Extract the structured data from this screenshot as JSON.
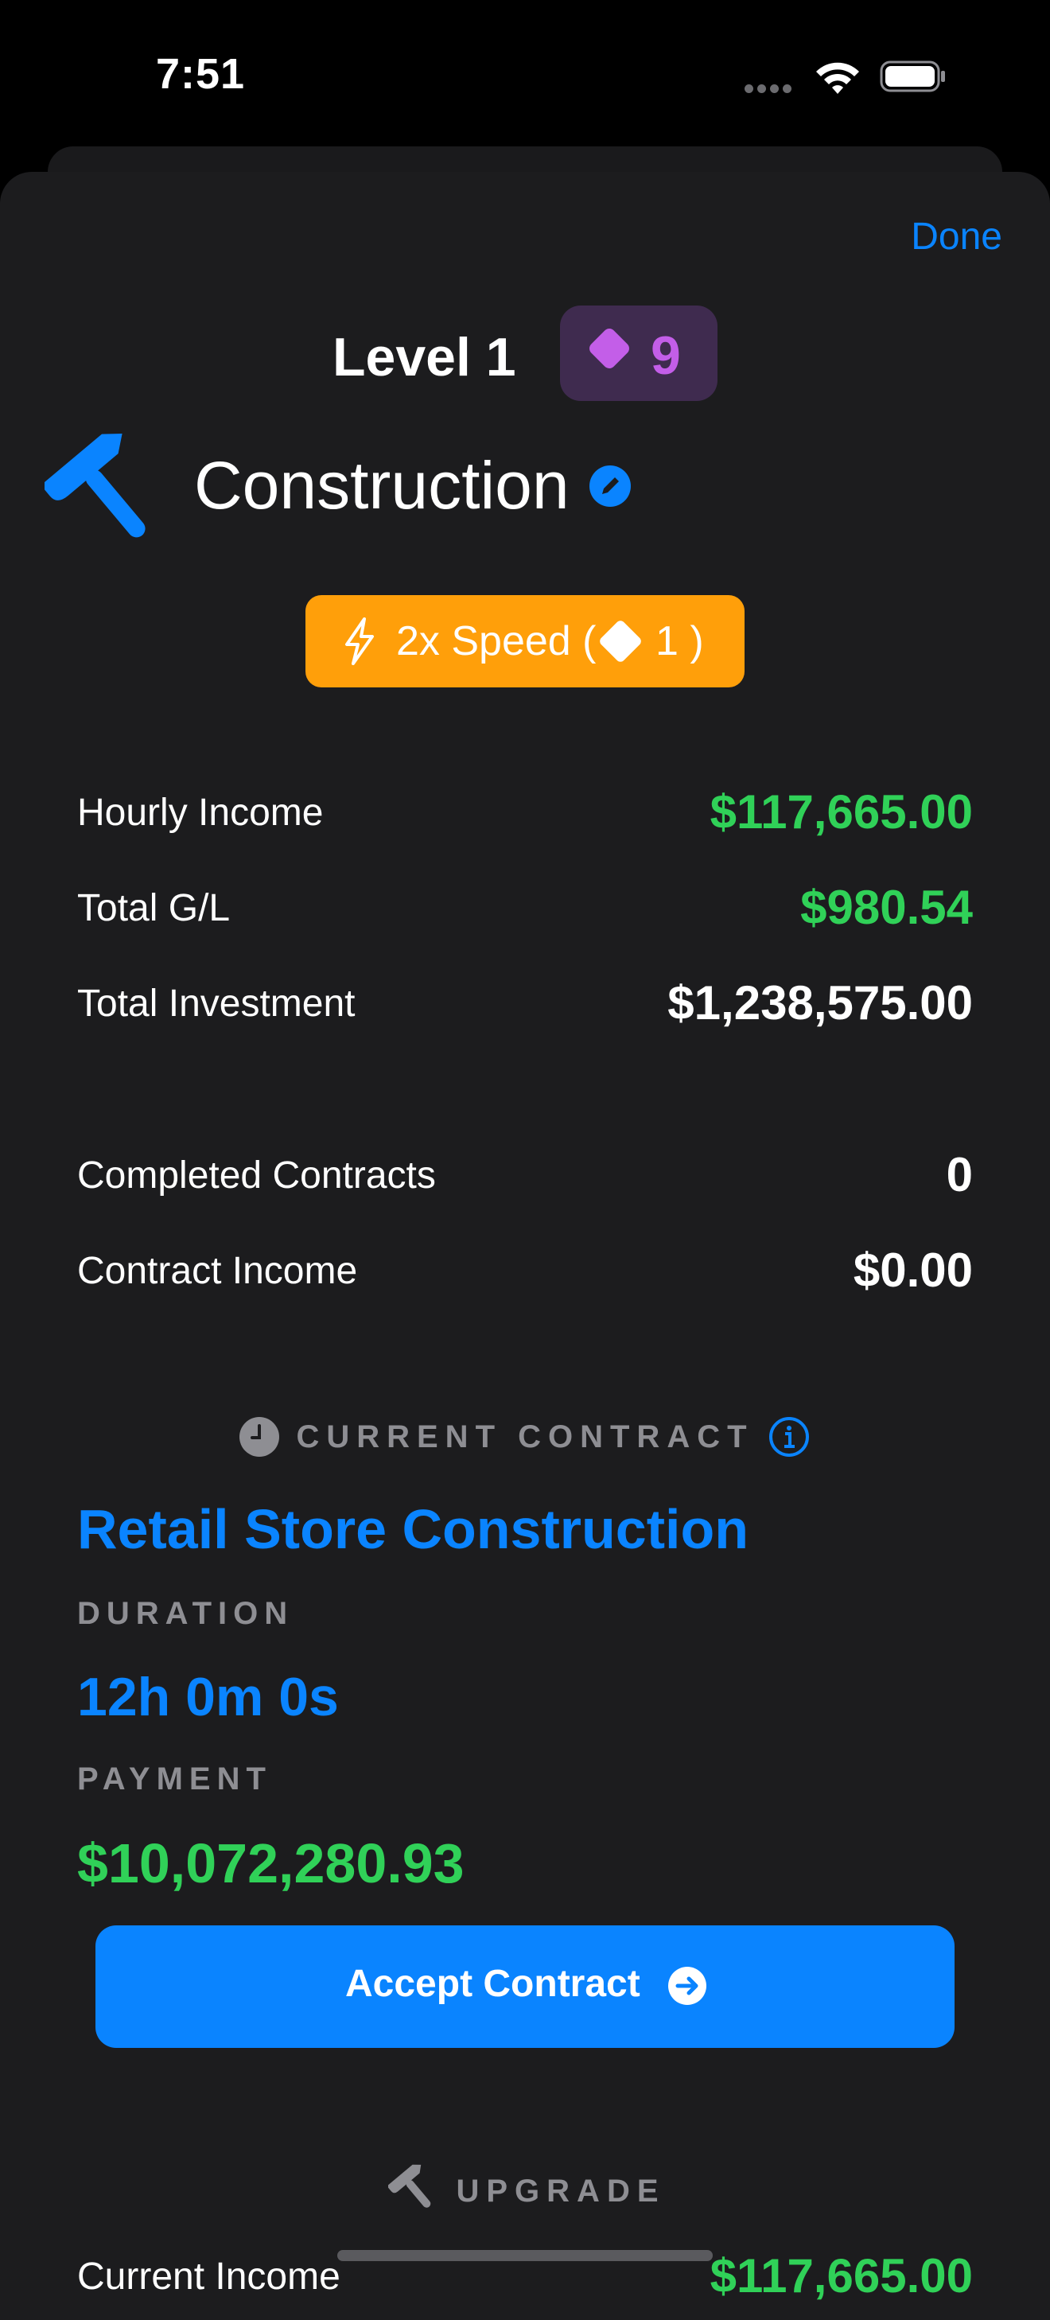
{
  "status_bar": {
    "time": "7:51"
  },
  "header": {
    "done_label": "Done",
    "level": "Level 1",
    "gems": "9"
  },
  "business": {
    "name": "Construction"
  },
  "speed_button": {
    "text": "2x Speed (",
    "count": "1 )"
  },
  "stats": [
    {
      "label": "Hourly Income",
      "value": "$117,665.00"
    },
    {
      "label": "Total G/L",
      "value": "$980.54"
    },
    {
      "label": "Total Investment",
      "value": "$1,238,575.00"
    },
    {
      "label": "Completed Contracts",
      "value": "0"
    },
    {
      "label": "Contract Income",
      "value": "$0.00"
    }
  ],
  "current_contract": {
    "header": "CURRENT CONTRACT",
    "name": "Retail Store Construction",
    "duration_label": "DURATION",
    "duration": "12h 0m 0s",
    "payment_label": "PAYMENT",
    "payment": "$10,072,280.93",
    "accept_label": "Accept Contract"
  },
  "upgrade": {
    "header": "UPGRADE",
    "current_income_label": "Current Income",
    "current_income": "$117,665.00"
  },
  "colors": {
    "accent": "#0a84ff",
    "positive": "#30d158",
    "speed": "#ff9f0a",
    "gem": "#c35ee8",
    "background": "#1c1c1e"
  },
  "icons": [
    "wifi-icon",
    "battery-icon",
    "hammer-icon",
    "edit-icon",
    "bolt-icon",
    "gem-icon",
    "clock-icon",
    "info-icon",
    "arrow-right-circle-icon"
  ]
}
